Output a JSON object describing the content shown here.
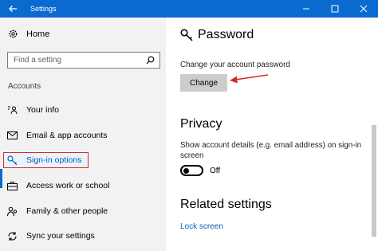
{
  "window": {
    "title": "Settings"
  },
  "sidebar": {
    "home_label": "Home",
    "search_placeholder": "Find a setting",
    "section_label": "Accounts",
    "items": [
      {
        "label": "Your info",
        "icon": "person-card-icon"
      },
      {
        "label": "Email & app accounts",
        "icon": "mail-icon"
      },
      {
        "label": "Sign-in options",
        "icon": "key-icon",
        "active": true
      },
      {
        "label": "Access work or school",
        "icon": "briefcase-icon"
      },
      {
        "label": "Family & other people",
        "icon": "people-icon"
      },
      {
        "label": "Sync your settings",
        "icon": "sync-icon"
      }
    ]
  },
  "main": {
    "password": {
      "title": "Password",
      "description": "Change your account password",
      "button_label": "Change"
    },
    "privacy": {
      "title": "Privacy",
      "description_line1": "Show account details (e.g. email address) on sign-in",
      "description_line2": "screen",
      "toggle_state": "Off"
    },
    "related": {
      "title": "Related settings",
      "link": "Lock screen"
    }
  },
  "colors": {
    "accent": "#0a6ad0",
    "highlight_border": "#d8262c",
    "arrow": "#d8262c"
  }
}
